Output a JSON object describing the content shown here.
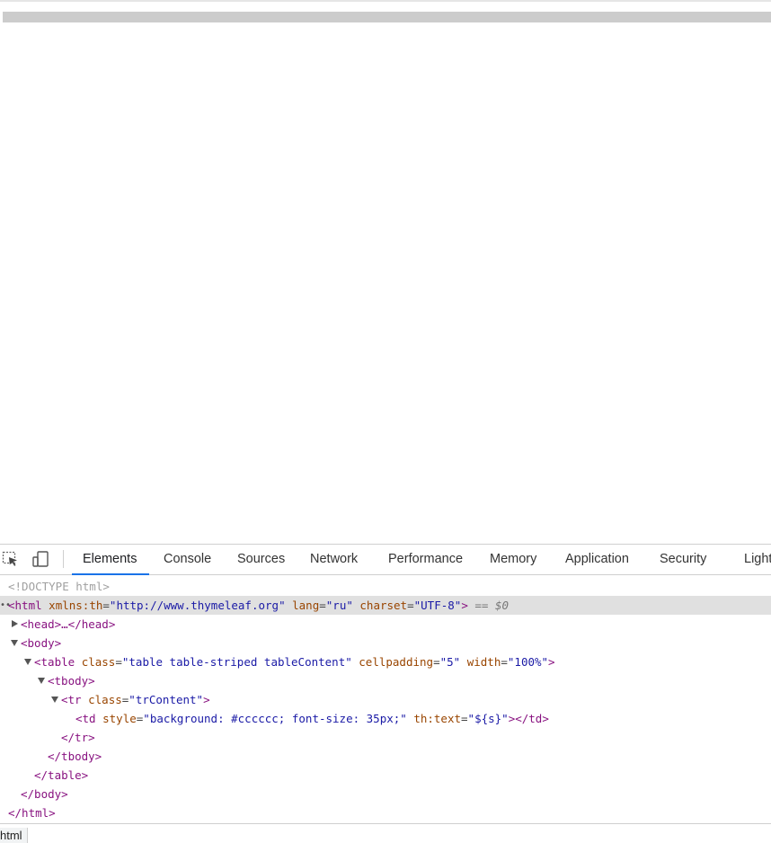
{
  "page": {},
  "devtools": {
    "tabs": [
      {
        "label": "Elements"
      },
      {
        "label": "Console"
      },
      {
        "label": "Sources"
      },
      {
        "label": "Network"
      },
      {
        "label": "Performance"
      },
      {
        "label": "Memory"
      },
      {
        "label": "Application"
      },
      {
        "label": "Security"
      },
      {
        "label": "Lighthouse"
      }
    ],
    "active_tab": "Elements",
    "accent": "#1a73e8",
    "tree": {
      "doctype": "<!DOCTYPE html>",
      "html_tag": "html",
      "html_attr1_name": "xmlns:th",
      "html_attr1_val": "\"http://www.thymeleaf.org\"",
      "html_attr2_name": "lang",
      "html_attr2_val": "\"ru\"",
      "html_attr3_name": "charset",
      "html_attr3_val": "\"UTF-8\"",
      "selected_marker": "== $0",
      "head_collapsed": "<head>…</head>",
      "body_open": "<body>",
      "table_tag": "table",
      "table_attr1_name": "class",
      "table_attr1_val": "\"table table-striped tableContent\"",
      "table_attr2_name": "cellpadding",
      "table_attr2_val": "\"5\"",
      "table_attr3_name": "width",
      "table_attr3_val": "\"100%\"",
      "tbody_open": "<tbody>",
      "tr_tag": "tr",
      "tr_attr_name": "class",
      "tr_attr_val": "\"trContent\"",
      "td_tag": "td",
      "td_attr1_name": "style",
      "td_attr1_val": "\"background: #cccccc; font-size: 35px;\"",
      "td_attr2_name": "th:text",
      "td_attr2_val": "\"${s}\"",
      "td_close": "</td>",
      "tr_close": "</tr>",
      "tbody_close": "</tbody>",
      "table_close": "</table>",
      "body_close": "</body>",
      "html_close": "</html>"
    },
    "breadcrumb": "html"
  }
}
